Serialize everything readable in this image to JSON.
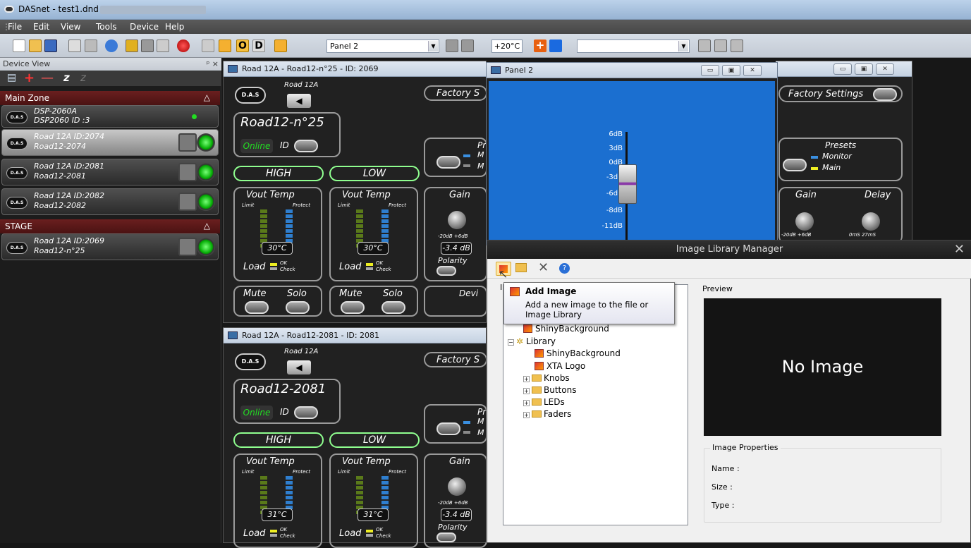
{
  "app": {
    "title": "DASnet - test1.dnd"
  },
  "menu": [
    "File",
    "Edit",
    "View",
    "Tools",
    "Device",
    "Help"
  ],
  "toolbar": {
    "panel_combo": "Panel 2",
    "temp_button": "+20°C",
    "empty_combo": ""
  },
  "device_view": {
    "title": "Device View",
    "pin": "ᵖ ×",
    "zones": [
      {
        "name": "Main Zone",
        "devices": [
          {
            "l1": "DSP-2060A",
            "l2": "DSP2060  ID :3"
          },
          {
            "l1": "Road 12A  ID:2074",
            "l2": "Road12-2074"
          },
          {
            "l1": "Road 12A  ID:2081",
            "l2": "Road12-2081"
          },
          {
            "l1": "Road 12A  ID:2082",
            "l2": "Road12-2082"
          }
        ]
      },
      {
        "name": "STAGE",
        "devices": [
          {
            "l1": "Road 12A  ID:2069",
            "l2": "Road12-n°25"
          }
        ]
      }
    ],
    "logo": "D.A.S"
  },
  "win1": {
    "title": "Road 12A - Road12-n°25 - ID: 2069",
    "model": "Road 12A",
    "name": "Road12-n°25",
    "online": "Online",
    "id": "ID",
    "factory": "Factory S",
    "presets": "Pr",
    "m1": "M",
    "m2": "M",
    "high": "HIGH",
    "low": "LOW",
    "vt": "Vout  Temp",
    "limit": "Limit",
    "protect": "Protect",
    "temp1": "30°C",
    "temp2": "30°C",
    "load": "Load",
    "ok": "OK",
    "check": "Check",
    "gain": "Gain",
    "gainrange": "-20dB  +6dB",
    "gainval": "-3.4 dB",
    "polarity": "Polarity",
    "mute": "Mute",
    "solo": "Solo",
    "dev": "Devi"
  },
  "win2": {
    "title": "Road 12A - Road12-2081 - ID: 2081",
    "model": "Road 12A",
    "name": "Road12-2081",
    "online": "Online",
    "id": "ID",
    "factory": "Factory S",
    "presets": "Pr",
    "m1": "M",
    "m2": "M",
    "high": "HIGH",
    "low": "LOW",
    "vt": "Vout  Temp",
    "limit": "Limit",
    "protect": "Protect",
    "temp1": "31°C",
    "temp2": "31°C",
    "load": "Load",
    "ok": "OK",
    "check": "Check",
    "gain": "Gain",
    "gainrange": "-20dB  +6dB",
    "gainval": "-3.4 dB",
    "polarity": "Polarity"
  },
  "win3": {
    "factory": "Factory Settings",
    "presets": "Presets",
    "monitor": "Monitor",
    "main": "Main",
    "gain": "Gain",
    "delay": "Delay",
    "gainrange": "-20dB  +6dB",
    "delayrange": "0mS    27mS"
  },
  "panel2": {
    "title": "Panel 2",
    "scale": [
      "6dB",
      "3dB",
      "0dB",
      "-3dB",
      "-6dB",
      "-8dB",
      "-11dB"
    ]
  },
  "ilm": {
    "title": "Image Library Manager",
    "tooltip_title": "Add Image",
    "tooltip_text": "Add a new image to the file or Image Library",
    "tree_label_partial": "I",
    "tree": [
      {
        "label": "ShinyBackground",
        "kind": "image"
      },
      {
        "label": "Library",
        "kind": "root"
      },
      {
        "label": "ShinyBackground",
        "kind": "image"
      },
      {
        "label": "XTA Logo",
        "kind": "image"
      },
      {
        "label": "Knobs",
        "kind": "folder"
      },
      {
        "label": "Buttons",
        "kind": "folder"
      },
      {
        "label": "LEDs",
        "kind": "folder"
      },
      {
        "label": "Faders",
        "kind": "folder"
      }
    ],
    "preview_label": "Preview",
    "no_image": "No Image",
    "props_title": "Image Properties",
    "name_label": "Name :",
    "size_label": "Size :",
    "type_label": "Type :"
  }
}
